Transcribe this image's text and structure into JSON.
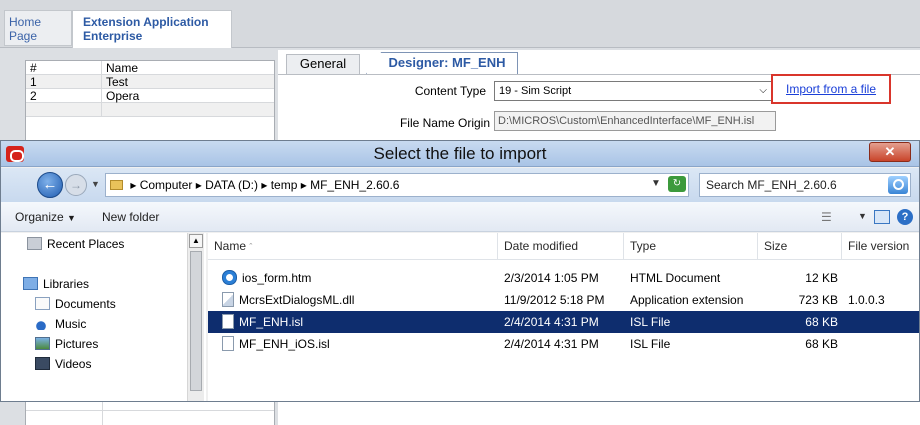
{
  "app": {
    "tabs": [
      {
        "label": "Home Page"
      },
      {
        "label": "Extension Application Enterprise"
      }
    ],
    "grid": {
      "headers": [
        "#",
        "Name"
      ],
      "rows": [
        {
          "num": "1",
          "name": "Test"
        },
        {
          "num": "2",
          "name": "Opera"
        }
      ]
    },
    "subtabs": [
      "General",
      "Designer: MF_ENH"
    ],
    "content_type_label": "Content Type",
    "content_type_value": "19 - Sim Script",
    "file_name_origin_label": "File Name Origin",
    "file_name_origin_value": "D:\\MICROS\\Custom\\EnhancedInterface\\MF_ENH.isl",
    "import_link": "Import from a file"
  },
  "dialog": {
    "title": "Select the file to import",
    "breadcrumb": [
      "Computer",
      "DATA (D:)",
      "temp",
      "MF_ENH_2.60.6"
    ],
    "search_placeholder": "Search MF_ENH_2.60.6",
    "toolbar": {
      "organize": "Organize",
      "new_folder": "New folder"
    },
    "nav": [
      {
        "label": "Recent Places",
        "icon": "recent-places-icon"
      },
      {
        "label": "Libraries",
        "icon": "libraries-icon"
      },
      {
        "label": "Documents",
        "icon": "documents-icon"
      },
      {
        "label": "Music",
        "icon": "music-icon"
      },
      {
        "label": "Pictures",
        "icon": "pictures-icon"
      },
      {
        "label": "Videos",
        "icon": "videos-icon"
      }
    ],
    "columns": [
      "Name",
      "Date modified",
      "Type",
      "Size",
      "File version"
    ],
    "files": [
      {
        "name": "ios_form.htm",
        "date": "2/3/2014 1:05 PM",
        "type": "HTML Document",
        "size": "12 KB",
        "version": "",
        "icon": "html-file-icon",
        "selected": false
      },
      {
        "name": "McrsExtDialogsML.dll",
        "date": "11/9/2012 5:18 PM",
        "type": "Application extension",
        "size": "723 KB",
        "version": "1.0.0.3",
        "icon": "dll-file-icon",
        "selected": false
      },
      {
        "name": "MF_ENH.isl",
        "date": "2/4/2014 4:31 PM",
        "type": "ISL File",
        "size": "68 KB",
        "version": "",
        "icon": "isl-file-icon",
        "selected": true
      },
      {
        "name": "MF_ENH_iOS.isl",
        "date": "2/4/2014 4:31 PM",
        "type": "ISL File",
        "size": "68 KB",
        "version": "",
        "icon": "isl-file-icon",
        "selected": false
      }
    ]
  },
  "colors": {
    "selection": "#0e2d6e",
    "link": "#1a3fd8",
    "highlight_border": "#d9352b",
    "tab_text": "#2d5aa4"
  }
}
